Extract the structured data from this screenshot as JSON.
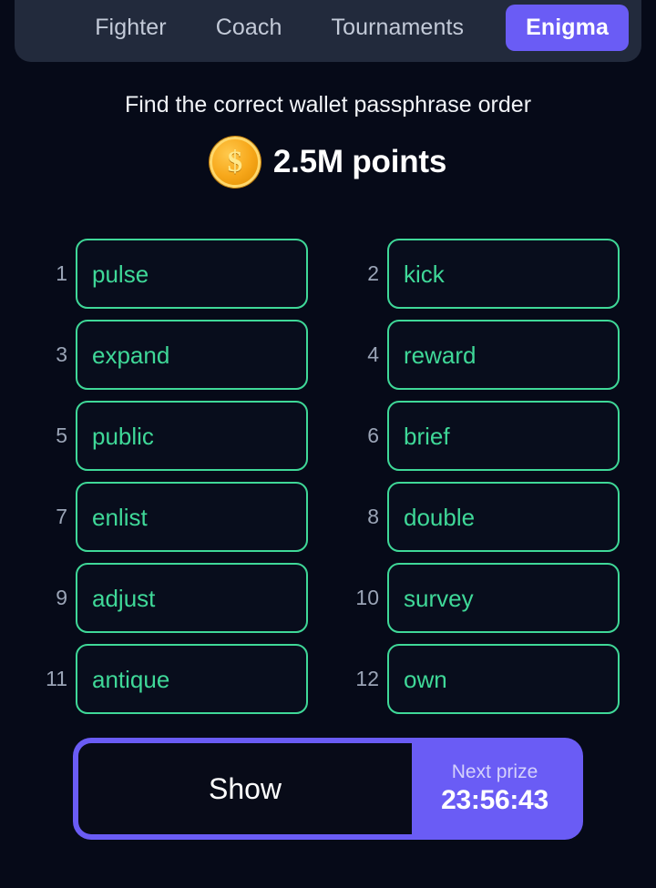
{
  "theme": {
    "background": "#060a18",
    "tabbar_bg": "#222a3c",
    "accent_purple": "#6a5cf5",
    "accent_green": "#3fd898",
    "coin_gold": "#f7a81b",
    "muted_text": "#9aa4b6"
  },
  "tabs": [
    {
      "label": "Fighter",
      "active": false
    },
    {
      "label": "Coach",
      "active": false
    },
    {
      "label": "Tournaments",
      "active": false
    },
    {
      "label": "Enigma",
      "active": true
    }
  ],
  "header": {
    "prompt": "Find the correct wallet passphrase order",
    "coin_icon": "coin-dollar-icon",
    "coin_glyph": "$",
    "points": "2.5M points"
  },
  "words": [
    {
      "index": "1",
      "word": "pulse"
    },
    {
      "index": "2",
      "word": "kick"
    },
    {
      "index": "3",
      "word": "expand"
    },
    {
      "index": "4",
      "word": "reward"
    },
    {
      "index": "5",
      "word": "public"
    },
    {
      "index": "6",
      "word": "brief"
    },
    {
      "index": "7",
      "word": "enlist"
    },
    {
      "index": "8",
      "word": "double"
    },
    {
      "index": "9",
      "word": "adjust"
    },
    {
      "index": "10",
      "word": "survey"
    },
    {
      "index": "11",
      "word": "antique"
    },
    {
      "index": "12",
      "word": "own"
    }
  ],
  "action": {
    "show_label": "Show",
    "prize_label": "Next prize",
    "prize_timer": "23:56:43"
  }
}
